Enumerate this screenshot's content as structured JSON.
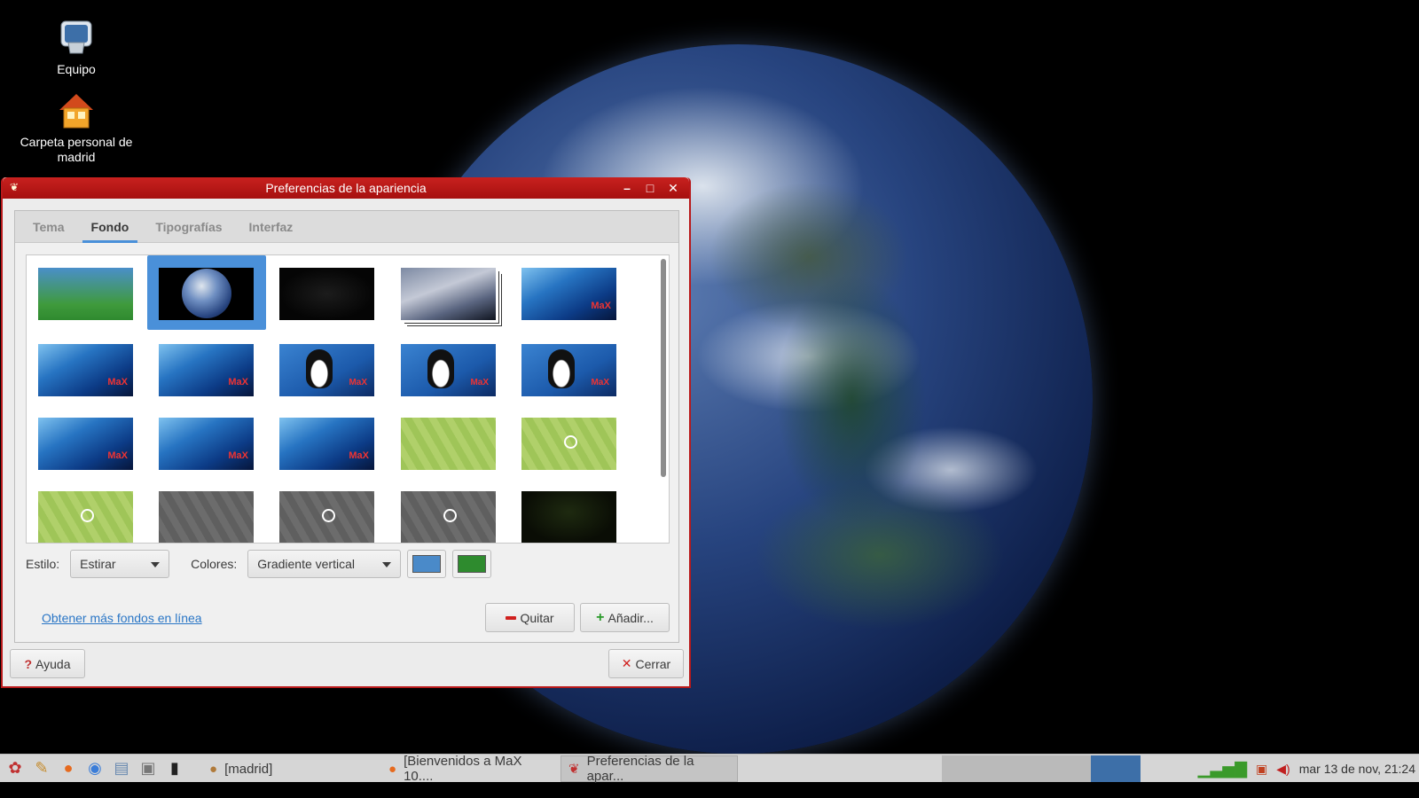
{
  "desktop": {
    "icons": [
      {
        "label": "Equipo"
      },
      {
        "label": "Carpeta personal de madrid"
      }
    ]
  },
  "window": {
    "title": "Preferencias de la apariencia",
    "controls": {
      "minimize": "–",
      "maximize": "□",
      "close": "✕"
    }
  },
  "tabs": [
    {
      "label": "Tema"
    },
    {
      "label": "Fondo",
      "active": true
    },
    {
      "label": "Tipografías"
    },
    {
      "label": "Interfaz"
    }
  ],
  "gallery": {
    "selected_index": 1,
    "thumbnails": [
      "t-green",
      "t-earth",
      "t-dark",
      "t-space",
      "t-max",
      "t-max",
      "t-max",
      "t-tux",
      "t-tux",
      "t-tux",
      "t-max",
      "t-max",
      "t-max",
      "t-hex",
      "t-hex-logo",
      "t-hex-logo",
      "t-gray",
      "t-gray-logo",
      "t-gray-logo",
      "t-night"
    ]
  },
  "style": {
    "label": "Estilo:",
    "value": "Estirar"
  },
  "colors": {
    "label": "Colores:",
    "value": "Gradiente vertical",
    "primary": "#4a8ac9",
    "secondary": "#2e8b2e"
  },
  "links": {
    "online": "Obtener más fondos en línea"
  },
  "buttons": {
    "remove": "Quitar",
    "add": "Añadir...",
    "help": "Ayuda",
    "close": "Cerrar"
  },
  "taskbar": {
    "tasks": [
      {
        "label": "[madrid]"
      },
      {
        "label": "[Bienvenidos a MaX 10...."
      },
      {
        "label": "Preferencias de la apar..."
      }
    ],
    "clock": "mar 13 de nov, 21:24"
  }
}
